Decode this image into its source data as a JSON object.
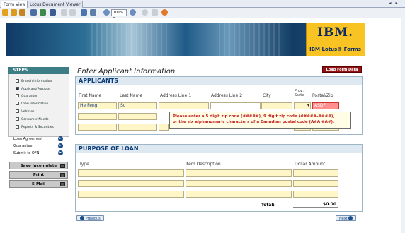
{
  "tabs": [
    "Form View",
    "Lotus Document Viewer"
  ],
  "toolbar": {
    "zoom": "100%"
  },
  "brand": {
    "logo": "IBM.",
    "product": "IBM Lotus® Forms"
  },
  "form": {
    "title": "Enter Applicant Information",
    "load_button": "Load Form Data"
  },
  "steps": {
    "heading": "STEPS",
    "items": [
      "Branch Information",
      "Applicant/Purpose",
      "Guarantor",
      "Loan Information",
      "Vehicles",
      "Consumer Needs",
      "Reports & Securities"
    ],
    "links": [
      "Loan Agreement",
      "Guarantee",
      "Submit to OFN"
    ]
  },
  "actions": {
    "save": "Save Incomplete",
    "print": "Print",
    "email": "E-Mail"
  },
  "applicants": {
    "heading": "APPLICANTS",
    "columns": [
      "First Name",
      "Last Name",
      "Address Line 1",
      "Address Line 2",
      "City",
      "Prov / State",
      "Postal/Zip"
    ],
    "row1": {
      "first": "He Feng",
      "last": "Su",
      "postal": "ASDF"
    },
    "error": [
      "Please enter a 5 digit zip code (#####), 9 digit zip code (#####-####),",
      "or the six alphanumeric characters of a Canadian postal code (A#A #A#)."
    ]
  },
  "purpose": {
    "heading": "PURPOSE OF LOAN",
    "columns": [
      "Type",
      "Item Description",
      "Dollar Amount"
    ],
    "total_label": "Total:",
    "total_value": "$0.00"
  },
  "nav": {
    "previous": "Previous",
    "next": "Next"
  }
}
